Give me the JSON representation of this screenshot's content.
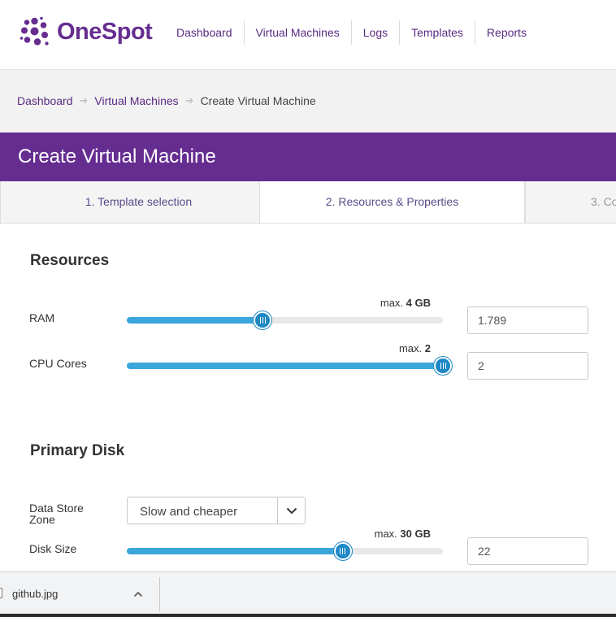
{
  "app": {
    "name": "OneSpot",
    "brand_color": "#662d91",
    "accent_color": "#3aa6dc"
  },
  "nav": {
    "items": [
      {
        "label": "Dashboard"
      },
      {
        "label": "Virtual Machines"
      },
      {
        "label": "Logs"
      },
      {
        "label": "Templates"
      },
      {
        "label": "Reports"
      }
    ]
  },
  "breadcrumb": {
    "items": [
      {
        "label": "Dashboard"
      },
      {
        "label": "Virtual Machines"
      }
    ],
    "current": "Create Virtual Machine",
    "separator_icon": "arrow-right-icon"
  },
  "page": {
    "title": "Create Virtual Machine"
  },
  "wizard": {
    "tabs": [
      {
        "label": "1. Template selection",
        "active": false
      },
      {
        "label": "2. Resources & Properties",
        "active": true
      },
      {
        "label": "3. Co",
        "active": false
      }
    ]
  },
  "resources": {
    "title": "Resources",
    "ram": {
      "label": "RAM",
      "max_prefix": "max.",
      "max_value": "4 GB",
      "value": "1.789",
      "fraction": 0.43
    },
    "cpu": {
      "label": "CPU Cores",
      "max_prefix": "max.",
      "max_value": "2",
      "value": "2",
      "fraction": 1.0
    }
  },
  "primary_disk": {
    "title": "Primary Disk",
    "data_store": {
      "label": "Data Store Zone",
      "selected": "Slow and cheaper",
      "caret_icon": "chevron-down-icon"
    },
    "disk_size": {
      "label": "Disk Size",
      "max_prefix": "max.",
      "max_value": "30 GB",
      "value": "22",
      "fraction": 0.683
    }
  },
  "download_bar": {
    "file_name": "github.jpg",
    "chevron_icon": "chevron-up-icon"
  }
}
